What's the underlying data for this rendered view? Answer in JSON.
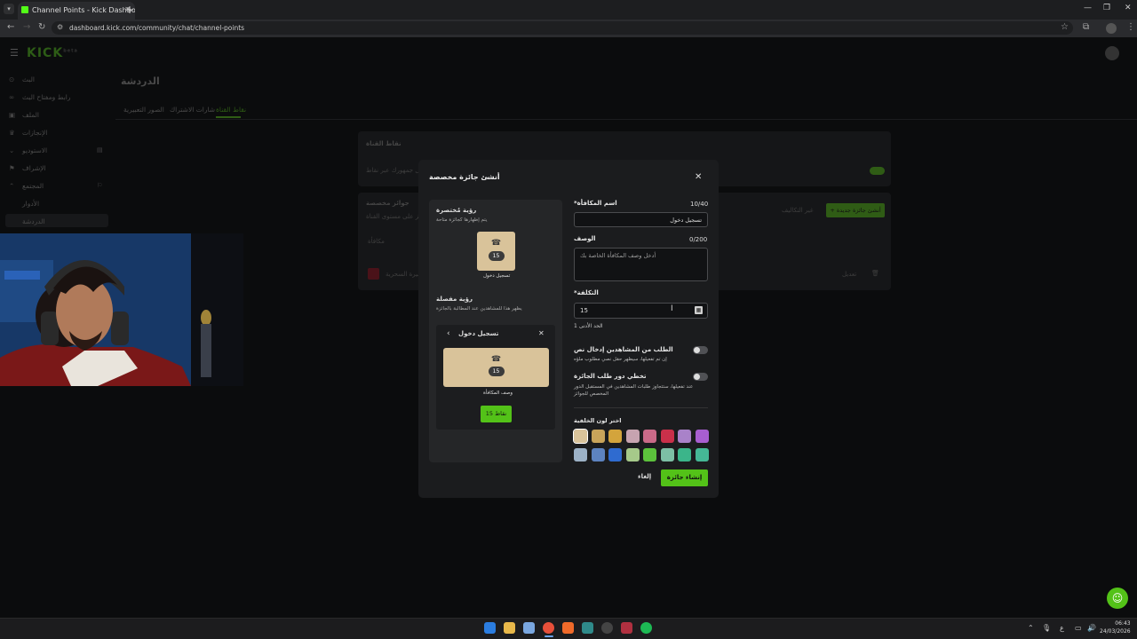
{
  "browser": {
    "tab_title": "Channel Points - Kick Dashboa",
    "url": "dashboard.kick.com/community/chat/channel-points",
    "new_tab": "+"
  },
  "app": {
    "logo": "KICK",
    "logo_sup": "beta",
    "sidebar": [
      {
        "label": "البث",
        "icon": "(•)"
      },
      {
        "label": "رابط ومفتاح البث",
        "icon": "∞"
      },
      {
        "label": "الملف",
        "icon": "▣"
      },
      {
        "label": "الإنجازات",
        "icon": "♛"
      },
      {
        "label": "الاستوديو",
        "icon": "⌄"
      },
      {
        "label": "الإشراف",
        "icon": "⚑"
      },
      {
        "label": "المجتمع",
        "icon": "⌃"
      },
      {
        "label": "الأدوار",
        "icon": ""
      },
      {
        "label": "الدردشة",
        "icon": ""
      }
    ],
    "page_title": "الدردشة",
    "tabs": [
      "نقاط القناة",
      "شارات الاشتراك",
      "الصور التعبيرية"
    ],
    "bg_card1_title": "نقاط القناة",
    "bg_card1_text": "قم بتعزيز تفاعل جمهورك عبر نقاط",
    "bg_card2_title": "جوائز مخصصة",
    "bg_card2_sub": "قم بإنشاء جوائز على مستوى القناة",
    "bg_create_btn": "+ أنشئ جائزة جديدة",
    "bg_edit_costs": "غير التكاليف",
    "bg_row_label": "بيرة السحرية",
    "bg_row_edit": "تعديل",
    "bg_col_header": "مكافأة"
  },
  "modal": {
    "title": "أنشئ جائزة مخصصة",
    "preview": {
      "compact_title": "رؤية مُختصرة",
      "compact_sub": "يتم إظهارها كجائزة متاحة",
      "card_cost": "15",
      "card_name": "تسجيل دخول",
      "detail_title": "رؤية مفصلة",
      "detail_sub": "يظهر هذا للمشاهدين عند المطالبة بالجائزة",
      "detail_header": "تسجيل دخول",
      "detail_desc": "وصف المكافأة",
      "detail_button": "15 نقاط"
    },
    "form": {
      "name_label": "*اسم المكافأة",
      "name_counter": "10/40",
      "name_value": "تسجيل دخول",
      "desc_label": "الوصف",
      "desc_counter": "0/200",
      "desc_placeholder": "أدخل وصف المكافأة الخاصة بك",
      "cost_label": "*التكلفة",
      "cost_value": "15",
      "cost_min": "الحد الأدنى 1",
      "toggle1_label": "الطلب من المشاهدين إدخال نص",
      "toggle1_help": "إن تم تفعيلها، سيظهر حقل نصي مطلوب ملؤه",
      "toggle2_label": "تخطي دور طلب الجائزة",
      "toggle2_help": "عند تفعيلها، ستتجاوز طلبات المشاهدين في المستقبل الدور المخصص للجوائز",
      "color_label": "اختر لون الخلفية",
      "colors": [
        "#d9c39a",
        "#c9a45a",
        "#d3a43c",
        "#c7a3b0",
        "#c96a88",
        "#c9304a",
        "#a982c9",
        "#a85ed0",
        "#9cb1c6",
        "#5d83c0",
        "#2f6bd0",
        "#a6c98a",
        "#5cc23c",
        "#7dbfa5",
        "#3bb58a",
        "#45b896"
      ],
      "cancel": "إلغاء",
      "create": "إنشاء جائزة"
    }
  },
  "taskbar": {
    "clock_time": "06:43",
    "clock_date": "24/03/2026",
    "lang": "ع"
  }
}
